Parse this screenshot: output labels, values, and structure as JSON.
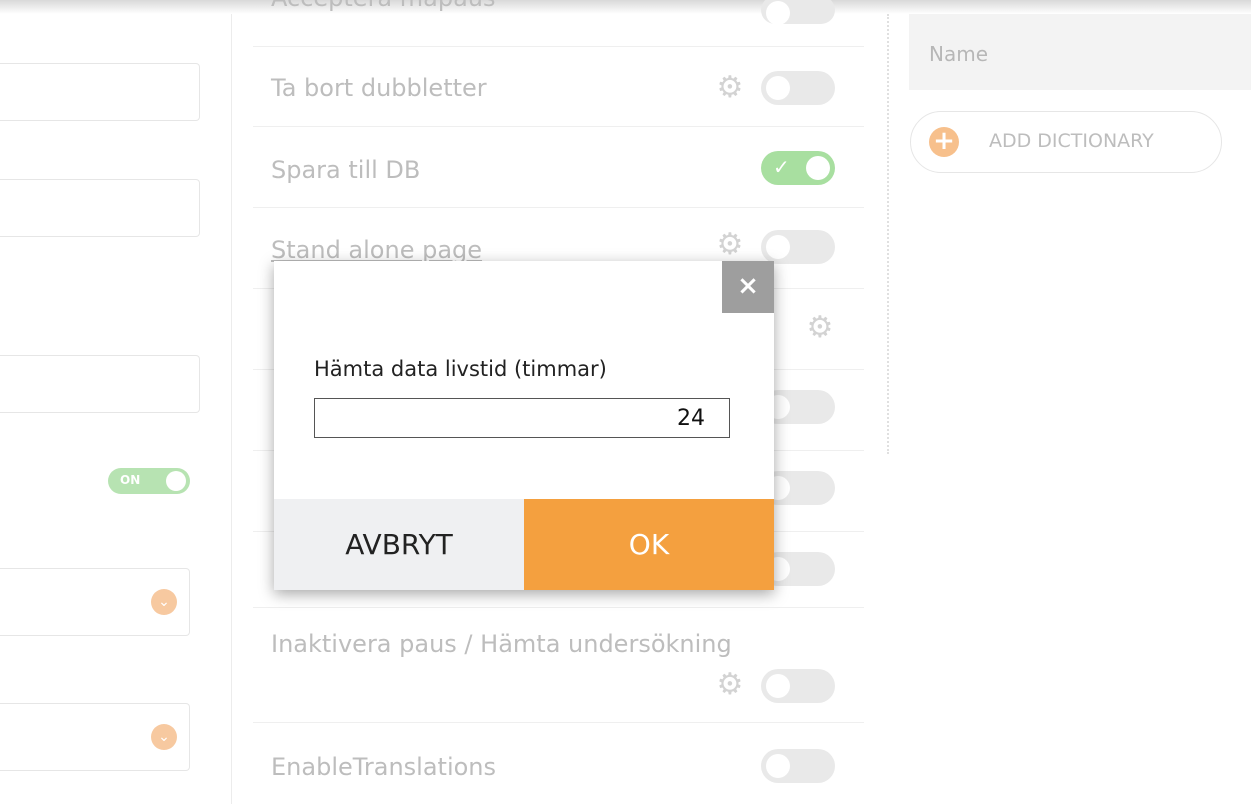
{
  "settings": {
    "rows": [
      {
        "label": "Acceptera mapaus",
        "toggle": "off"
      },
      {
        "label": "Ta bort dubbletter",
        "toggle": "off"
      },
      {
        "label": "Spara till DB",
        "toggle": "on"
      },
      {
        "label": "Stand alone page",
        "toggle": "off"
      },
      {
        "label": "Inaktivera paus / Hämta undersökning",
        "toggle": "off"
      },
      {
        "label": "EnableTranslations",
        "toggle": "off"
      }
    ],
    "on_label": "ON",
    "check_glyph": "✓"
  },
  "right_panel": {
    "column_header": "Name",
    "add_button_label": "ADD DICTIONARY"
  },
  "modal": {
    "close_glyph": "×",
    "field_label": "Hämta data livstid (timmar)",
    "field_value": "24",
    "cancel_label": "AVBRYT",
    "ok_label": "OK"
  },
  "colors": {
    "accent_orange": "#f4a03f",
    "toggle_on": "#a8dfa0",
    "close_gray": "#9e9e9e"
  },
  "icons": {
    "gear": "gear-icon",
    "chevron": "chevron-down-icon",
    "plus": "plus-icon",
    "close": "close-icon",
    "check": "check-icon"
  }
}
